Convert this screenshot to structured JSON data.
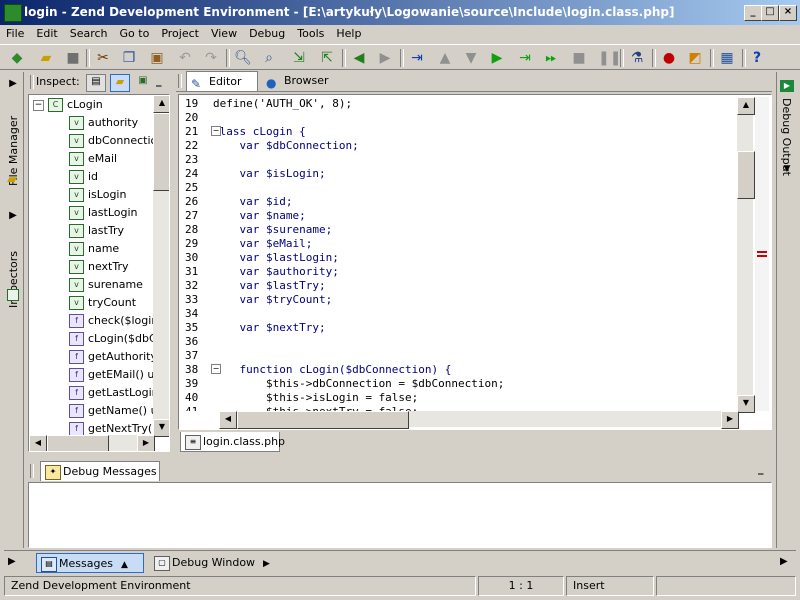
{
  "window": {
    "title": "login - Zend Development Environment - [E:\\artykuły\\Logowanie\\source\\Include\\login.class.php]"
  },
  "menu": [
    "File",
    "Edit",
    "Search",
    "Go to",
    "Project",
    "View",
    "Debug",
    "Tools",
    "Help"
  ],
  "side_left": {
    "file_manager": "File Manager",
    "inspectors": "Inspectors"
  },
  "side_right": {
    "debug_output": "Debug Output"
  },
  "inspect": {
    "label": "Inspect:",
    "root": "cLogin",
    "items": [
      "authority",
      "dbConnection",
      "eMail",
      "id",
      "isLogin",
      "lastLogin",
      "lastTry",
      "name",
      "nextTry",
      "surename",
      "tryCount",
      "check($login,",
      "cLogin($dbCo",
      "getAuthority",
      "getEMail()  u",
      "getLastLogin",
      "getName()  u",
      "getNextTry()"
    ]
  },
  "editor_tabs": {
    "editor": "Editor",
    "browser": "Browser"
  },
  "code": [
    {
      "n": "19",
      "t": "define('AUTH_OK', 8);"
    },
    {
      "n": "20",
      "t": ""
    },
    {
      "n": "21",
      "t": "class cLogin {"
    },
    {
      "n": "22",
      "t": "    var $dbConnection;"
    },
    {
      "n": "23",
      "t": ""
    },
    {
      "n": "24",
      "t": "    var $isLogin;"
    },
    {
      "n": "25",
      "t": ""
    },
    {
      "n": "26",
      "t": "    var $id;"
    },
    {
      "n": "27",
      "t": "    var $name;"
    },
    {
      "n": "28",
      "t": "    var $surename;"
    },
    {
      "n": "29",
      "t": "    var $eMail;"
    },
    {
      "n": "30",
      "t": "    var $lastLogin;"
    },
    {
      "n": "31",
      "t": "    var $authority;"
    },
    {
      "n": "32",
      "t": "    var $lastTry;"
    },
    {
      "n": "33",
      "t": "    var $tryCount;"
    },
    {
      "n": "34",
      "t": ""
    },
    {
      "n": "35",
      "t": "    var $nextTry;"
    },
    {
      "n": "36",
      "t": ""
    },
    {
      "n": "37",
      "t": ""
    },
    {
      "n": "38",
      "t": "    function cLogin($dbConnection) {"
    },
    {
      "n": "39",
      "t": "        $this->dbConnection = $dbConnection;"
    },
    {
      "n": "40",
      "t": "        $this->isLogin = false;"
    },
    {
      "n": "41",
      "t": "        $this->nextTry = false;"
    }
  ],
  "file_tab": "login.class.php",
  "debug_messages": {
    "title": "Debug Messages"
  },
  "bottom_tabs": {
    "messages": "Messages",
    "debug_window": "Debug Window"
  },
  "status": {
    "app": "Zend Development Environment",
    "position": "1 : 1",
    "mode": "Insert"
  },
  "colors": {
    "title_start": "#0a246a",
    "title_end": "#a6caf0",
    "keyword": "#000080",
    "string": "#8b0000"
  }
}
